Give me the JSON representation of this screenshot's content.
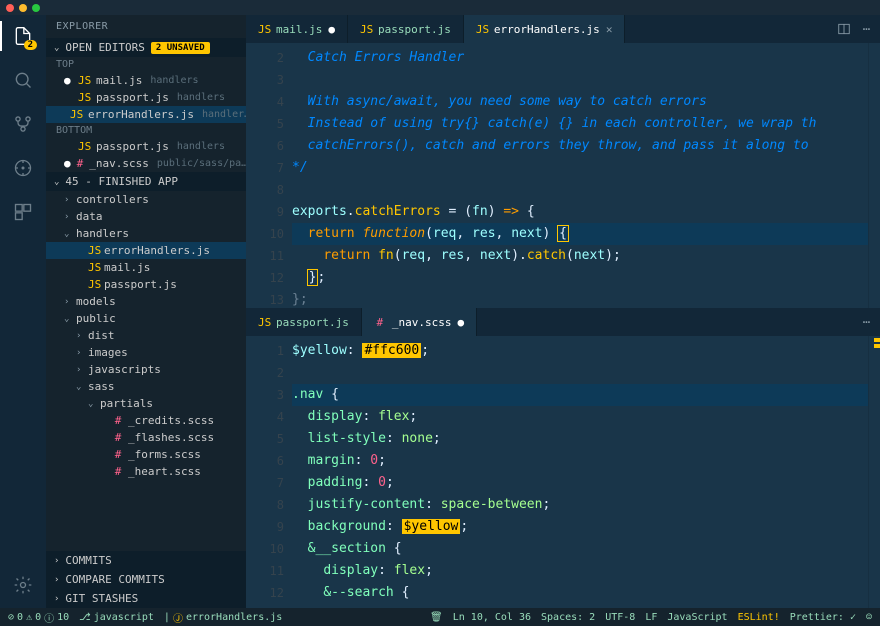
{
  "titlebar": {
    "dots": [
      "#ff5f57",
      "#febc2e",
      "#28c840"
    ]
  },
  "activity": {
    "badge": "2"
  },
  "sidebar": {
    "title": "EXPLORER",
    "open_editors": {
      "label": "OPEN EDITORS",
      "badge": "2 UNSAVED"
    },
    "groups": {
      "top": {
        "label": "TOP",
        "items": [
          {
            "name": "mail.js",
            "path": "handlers",
            "dirty": true
          },
          {
            "name": "passport.js",
            "path": "handlers"
          },
          {
            "name": "errorHandlers.js",
            "path": "handler…",
            "active": true
          }
        ]
      },
      "bottom": {
        "label": "BOTTOM",
        "items": [
          {
            "name": "passport.js",
            "path": "handlers"
          },
          {
            "name": "_nav.scss",
            "path": "public/sass/pa…",
            "dirty": true,
            "scss": true
          }
        ]
      }
    },
    "folder": {
      "label": "45 - FINISHED APP"
    },
    "tree": [
      {
        "t": "controllers",
        "d": 1,
        "c": "›"
      },
      {
        "t": "data",
        "d": 1,
        "c": "›"
      },
      {
        "t": "handlers",
        "d": 1,
        "c": "⌄",
        "open": true
      },
      {
        "t": "errorHandlers.js",
        "d": 2,
        "f": "js",
        "active": true
      },
      {
        "t": "mail.js",
        "d": 2,
        "f": "js"
      },
      {
        "t": "passport.js",
        "d": 2,
        "f": "js"
      },
      {
        "t": "models",
        "d": 1,
        "c": "›"
      },
      {
        "t": "public",
        "d": 1,
        "c": "⌄",
        "open": true
      },
      {
        "t": "dist",
        "d": 2,
        "c": "›"
      },
      {
        "t": "images",
        "d": 2,
        "c": "›"
      },
      {
        "t": "javascripts",
        "d": 2,
        "c": "›"
      },
      {
        "t": "sass",
        "d": 2,
        "c": "⌄",
        "open": true
      },
      {
        "t": "partials",
        "d": 3,
        "c": "⌄",
        "open": true
      },
      {
        "t": "_credits.scss",
        "d": 4,
        "f": "scss"
      },
      {
        "t": "_flashes.scss",
        "d": 4,
        "f": "scss"
      },
      {
        "t": "_forms.scss",
        "d": 4,
        "f": "scss"
      },
      {
        "t": "_heart.scss",
        "d": 4,
        "f": "scss"
      }
    ],
    "bottom_sections": [
      "COMMITS",
      "COMPARE COMMITS",
      "GIT STASHES"
    ]
  },
  "pane1": {
    "tabs": [
      {
        "name": "mail.js",
        "dirty": true
      },
      {
        "name": "passport.js"
      },
      {
        "name": "errorHandlers.js",
        "active": true,
        "close": true
      }
    ],
    "lines": [
      {
        "n": 2,
        "html": "  <span class='c-comment'>Catch Errors Handler</span>"
      },
      {
        "n": 3,
        "html": ""
      },
      {
        "n": 4,
        "html": "  <span class='c-comment'>With async/await, you need some way to catch errors</span>"
      },
      {
        "n": 5,
        "html": "  <span class='c-comment'>Instead of using try{} catch(e) {} in each controller, we wrap th</span>"
      },
      {
        "n": 6,
        "html": "  <span class='c-comment'>catchErrors(), catch and errors they throw, and pass it along to</span>"
      },
      {
        "n": 7,
        "html": "<span class='c-comment'>*/</span>"
      },
      {
        "n": 8,
        "html": ""
      },
      {
        "n": 9,
        "html": "<span class='c-var'>exports</span><span class='c-punc'>.</span><span class='c-fn'>catchErrors</span> <span class='c-punc'>=</span> <span class='c-punc'>(</span><span class='c-var'>fn</span><span class='c-punc'>)</span> <span class='c-kw'>=&gt;</span> <span class='c-punc'>{</span>"
      },
      {
        "n": 10,
        "hl": true,
        "html": "  <span class='c-kw'>return</span> <span class='c-kw2'>function</span><span class='c-punc'>(</span><span class='c-var'>req</span><span class='c-punc'>,</span> <span class='c-var'>res</span><span class='c-punc'>,</span> <span class='c-var'>next</span><span class='c-punc'>)</span> <span class='cursor-box'>{</span>"
      },
      {
        "n": 11,
        "html": "    <span class='c-kw'>return</span> <span class='c-fn'>fn</span><span class='c-punc'>(</span><span class='c-var'>req</span><span class='c-punc'>,</span> <span class='c-var'>res</span><span class='c-punc'>,</span> <span class='c-var'>next</span><span class='c-punc'>).</span><span class='c-fn'>catch</span><span class='c-punc'>(</span><span class='c-var'>next</span><span class='c-punc'>);</span>"
      },
      {
        "n": 12,
        "html": "  <span class='cursor-box'>}</span><span class='c-punc'>;</span>"
      },
      {
        "n": 13,
        "html": "<span class='c-punc' style='opacity:.4'>};</span>"
      }
    ]
  },
  "pane2": {
    "tabs": [
      {
        "name": "passport.js"
      },
      {
        "name": "_nav.scss",
        "dirty": true,
        "active": true,
        "scss": true
      }
    ],
    "lines": [
      {
        "n": 1,
        "html": "<span class='c-var'>$yellow</span><span class='c-punc'>:</span> <span class='hl-box'>#ffc600</span><span class='c-punc'>;</span>"
      },
      {
        "n": 2,
        "html": ""
      },
      {
        "n": 3,
        "hl": true,
        "html": "<span class='c-prop'>.nav</span> <span class='c-punc'>{</span>"
      },
      {
        "n": 4,
        "html": "  <span class='c-prop'>display</span><span class='c-punc'>:</span> <span class='c-val'>flex</span><span class='c-punc'>;</span>"
      },
      {
        "n": 5,
        "html": "  <span class='c-prop'>list-style</span><span class='c-punc'>:</span> <span class='c-val'>none</span><span class='c-punc'>;</span>"
      },
      {
        "n": 6,
        "html": "  <span class='c-prop'>margin</span><span class='c-punc'>:</span> <span class='c-num'>0</span><span class='c-punc'>;</span>"
      },
      {
        "n": 7,
        "html": "  <span class='c-prop'>padding</span><span class='c-punc'>:</span> <span class='c-num'>0</span><span class='c-punc'>;</span>"
      },
      {
        "n": 8,
        "html": "  <span class='c-prop'>justify-content</span><span class='c-punc'>:</span> <span class='c-val'>space-between</span><span class='c-punc'>;</span>"
      },
      {
        "n": 9,
        "html": "  <span class='c-prop'>background</span><span class='c-punc'>:</span> <span class='hl-box'>$yellow</span><span class='c-punc'>;</span>"
      },
      {
        "n": 10,
        "html": "  <span class='c-prop'>&amp;__section</span> <span class='c-punc'>{</span>"
      },
      {
        "n": 11,
        "html": "    <span class='c-prop'>display</span><span class='c-punc'>:</span> <span class='c-val'>flex</span><span class='c-punc'>;</span>"
      },
      {
        "n": 12,
        "html": "    <span class='c-prop'>&amp;--search</span> <span class='c-punc'>{</span>"
      }
    ]
  },
  "status": {
    "errors": "0",
    "warnings": "0",
    "info": "10",
    "branch": "javascript",
    "file": "errorHandlers.js",
    "pos": "Ln 10, Col 36",
    "spaces": "Spaces: 2",
    "enc": "UTF-8",
    "eol": "LF",
    "lang": "JavaScript",
    "eslint": "ESLint!",
    "prettier": "Prettier: ✓"
  }
}
